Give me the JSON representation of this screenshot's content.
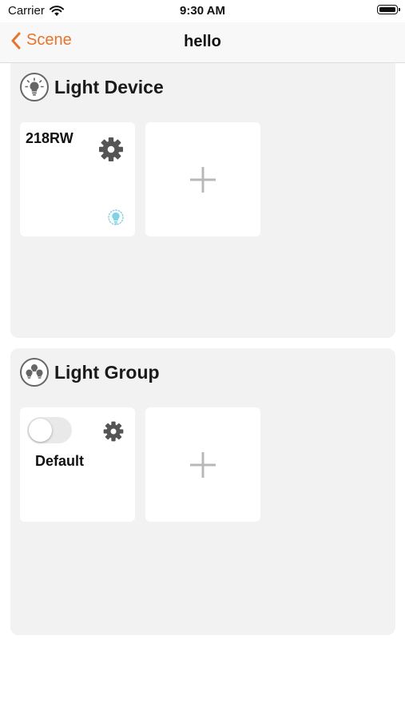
{
  "status_bar": {
    "carrier": "Carrier",
    "time": "9:30 AM"
  },
  "nav": {
    "back_label": "Scene",
    "title": "hello"
  },
  "light_device": {
    "title": "Light Device",
    "devices": [
      {
        "name": "218RW",
        "indicator_color": "#7fd3e6"
      }
    ]
  },
  "light_group": {
    "title": "Light Group",
    "groups": [
      {
        "name": "Default",
        "switch_on": false
      }
    ]
  },
  "colors": {
    "accent": "#e8732a",
    "panel": "#f2f2f2",
    "indicator": "#7fd3e6"
  }
}
